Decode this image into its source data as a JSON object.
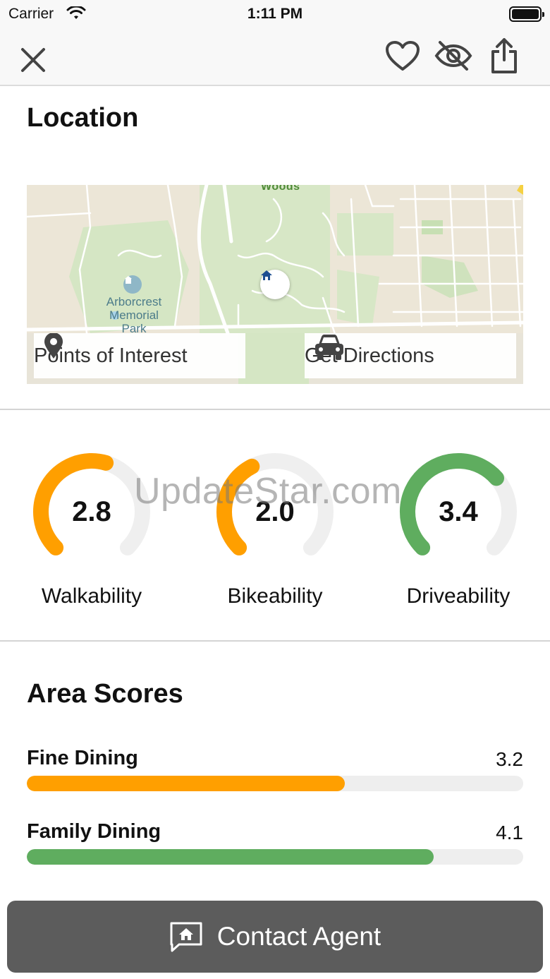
{
  "status_bar": {
    "carrier": "Carrier",
    "time": "1:11 PM"
  },
  "nav": {
    "close_icon": "close-icon",
    "actions": [
      "heart-icon",
      "eye-slash-icon",
      "share-icon"
    ]
  },
  "location": {
    "title": "Location",
    "map": {
      "labels": {
        "woods": "Woods",
        "park": "Arborcrest Memorial Park"
      },
      "points_of_interest_label": "Points of Interest",
      "get_directions_label": "Get Directions"
    }
  },
  "gauges": [
    {
      "value": "2.8",
      "label": "Walkability",
      "fraction": 0.56,
      "color": "#ff9f00"
    },
    {
      "value": "2.0",
      "label": "Bikeability",
      "fraction": 0.4,
      "color": "#ff9f00"
    },
    {
      "value": "3.4",
      "label": "Driveability",
      "fraction": 0.68,
      "color": "#5fad5f"
    }
  ],
  "watermark": "UpdateStar.com",
  "area_scores": {
    "title": "Area Scores",
    "items": [
      {
        "label": "Fine Dining",
        "value": "3.2",
        "fraction": 0.64,
        "color": "#ff9f00"
      },
      {
        "label": "Family Dining",
        "value": "4.1",
        "fraction": 0.82,
        "color": "#5fad5f"
      }
    ]
  },
  "contact": {
    "label": "Contact Agent"
  },
  "colors": {
    "orange": "#ff9f00",
    "green": "#5fad5f",
    "track": "#eeeeee",
    "button": "#5c5c5c"
  }
}
